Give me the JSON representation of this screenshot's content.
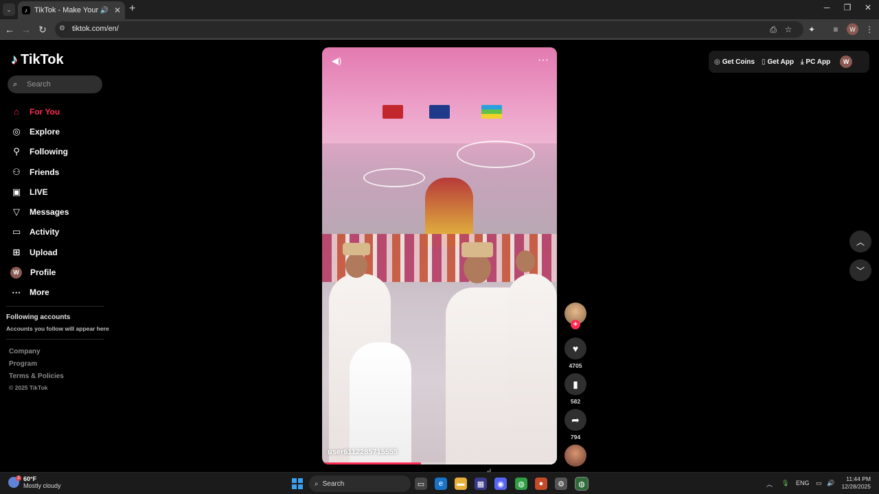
{
  "browser": {
    "tab_title": "TikTok - Make Your Day",
    "tab_close": "✕",
    "new_tab": "+",
    "url": "tiktok.com/en/",
    "profile_initial": "W"
  },
  "sidebar": {
    "logo_text": "TikTok",
    "search_placeholder": "Search",
    "items": [
      {
        "label": "For You"
      },
      {
        "label": "Explore"
      },
      {
        "label": "Following"
      },
      {
        "label": "Friends"
      },
      {
        "label": "LIVE"
      },
      {
        "label": "Messages"
      },
      {
        "label": "Activity"
      },
      {
        "label": "Upload"
      },
      {
        "label": "Profile",
        "avatar": "W"
      },
      {
        "label": "More"
      }
    ],
    "following_heading": "Following accounts",
    "following_sub": "Accounts you follow will appear here",
    "footer": {
      "company": "Company",
      "program": "Program",
      "terms": "Terms & Policies",
      "copyright": "© 2025 TikTok"
    }
  },
  "topbar": {
    "get_coins": "Get Coins",
    "get_app": "Get App",
    "pc_app": "PC App",
    "avatar": "W"
  },
  "video": {
    "author": "user6112285715555",
    "progress": 0.42
  },
  "actions": {
    "follow_plus": "+",
    "likes": "4705",
    "saves": "582",
    "shares": "794"
  },
  "taskbar": {
    "temp": "60°F",
    "weather": "Mostly cloudy",
    "weather_badge": "2",
    "search": "Search",
    "lang": "ENG",
    "time": "11:44 PM",
    "date": "12/28/2025"
  },
  "colors": {
    "accent": "#fe2c55",
    "page_bg": "#000000"
  }
}
